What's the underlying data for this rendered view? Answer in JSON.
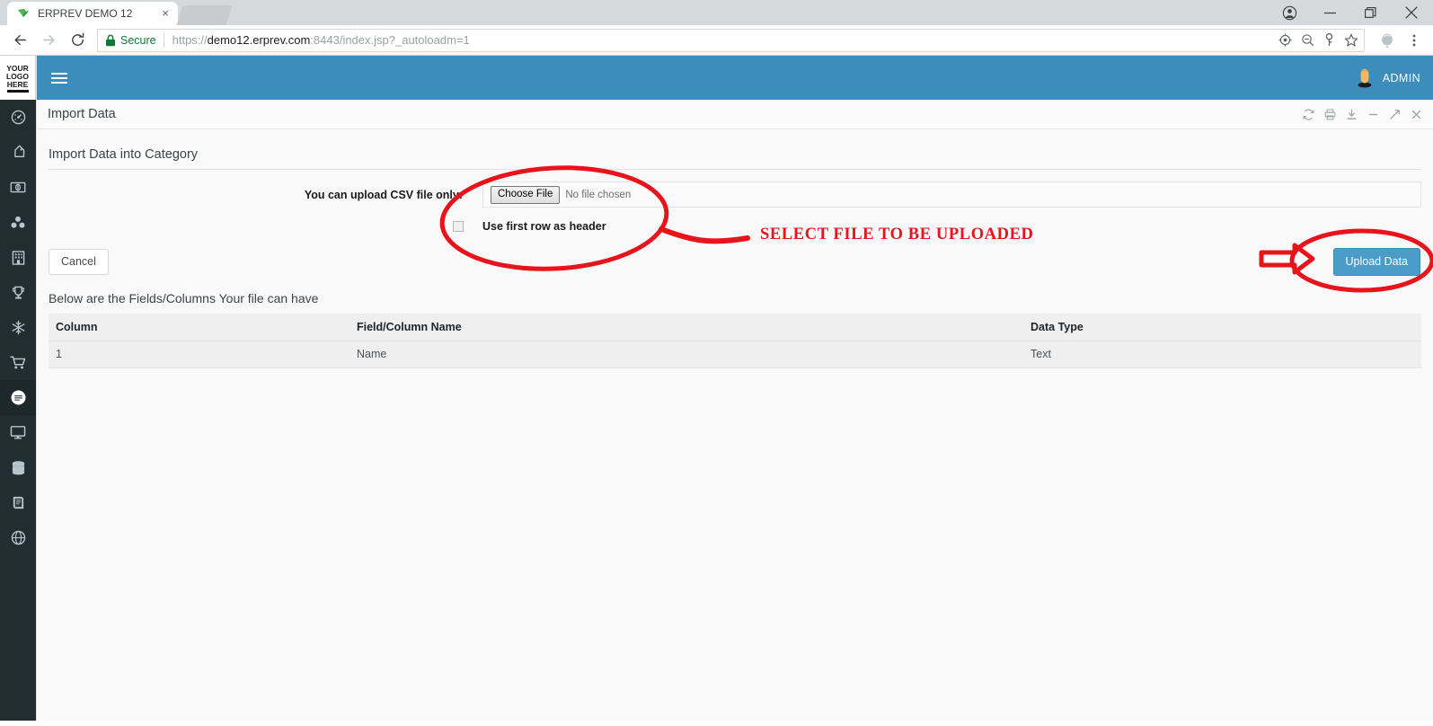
{
  "browser": {
    "tab": {
      "title": "ERPREV DEMO 12",
      "favicon": "bird-favicon",
      "close": "×"
    },
    "window_controls": {
      "profile": "profile-icon",
      "minimize": "—",
      "maximize": "maximize-icon",
      "close": "×"
    },
    "toolbar": {
      "back": "←",
      "forward": "→",
      "reload": "↻",
      "secure_label": "Secure",
      "url_full": "https://demo12.erprev.com:8443/index.jsp?_autoloadm=1",
      "url_scheme": "https://",
      "url_host": "demo12.erprev.com",
      "url_rest": ":8443/index.jsp?_autoloadm=1",
      "icons": [
        "location-target-icon",
        "zoom-out-icon",
        "key-icon",
        "bookmark-star-icon"
      ],
      "extension": "extension-balloon-icon",
      "menu": "kebab-menu-icon"
    }
  },
  "sidebar": {
    "logo": {
      "line1": "YOUR",
      "line2": "LOGO",
      "line3": "HERE"
    },
    "items": [
      {
        "name": "dashboard",
        "icon": "gauge-icon",
        "active": false
      },
      {
        "name": "tags",
        "icon": "tags-icon",
        "active": false
      },
      {
        "name": "money",
        "icon": "money-icon",
        "active": false
      },
      {
        "name": "cubes",
        "icon": "cubes-icon",
        "active": false
      },
      {
        "name": "building",
        "icon": "building-icon",
        "active": false
      },
      {
        "name": "trophy",
        "icon": "trophy-icon",
        "active": false
      },
      {
        "name": "snowflake",
        "icon": "snowflake-icon",
        "active": false
      },
      {
        "name": "cart",
        "icon": "shopping-cart-icon",
        "active": false
      },
      {
        "name": "chat",
        "icon": "comment-circle-icon",
        "active": true
      },
      {
        "name": "desktop",
        "icon": "desktop-icon",
        "active": false
      },
      {
        "name": "database",
        "icon": "database-icon",
        "active": false
      },
      {
        "name": "book",
        "icon": "book-icon",
        "active": false
      },
      {
        "name": "globe",
        "icon": "globe-icon",
        "active": false
      }
    ]
  },
  "topbar": {
    "menu_toggle": "hamburger-icon",
    "user_label": "ADMIN",
    "avatar": "user-avatar"
  },
  "panel": {
    "title": "Import Data",
    "tools": [
      {
        "name": "refresh",
        "glyph": "refresh-icon"
      },
      {
        "name": "print",
        "glyph": "print-icon"
      },
      {
        "name": "download",
        "glyph": "download-icon"
      },
      {
        "name": "minimize",
        "glyph": "minimize-icon"
      },
      {
        "name": "expand",
        "glyph": "expand-icon"
      },
      {
        "name": "close",
        "glyph": "close-icon"
      }
    ]
  },
  "form": {
    "section_title": "Import Data into Category",
    "upload_label": "You can upload CSV file only:",
    "choose_file_button": "Choose File",
    "no_file_chosen": "No file chosen",
    "checkbox_label": "Use first row as header",
    "checkbox_checked": false,
    "cancel_button": "Cancel",
    "upload_button": "Upload Data"
  },
  "fields": {
    "note": "Below are the Fields/Columns Your file can have",
    "headers": [
      "Column",
      "Field/Column Name",
      "Data Type"
    ],
    "rows": [
      [
        "1",
        "Name",
        "Text"
      ]
    ]
  },
  "annotations": {
    "text": "SELECT FILE TO BE UPLOADED",
    "color": "#e8141b",
    "shapes": [
      "ellipse-around-file-chooser",
      "line-connector-to-text",
      "arrow-pointing-to-upload-button",
      "ellipse-around-upload-button"
    ]
  },
  "colors": {
    "topbar_blue": "#3c8dbc",
    "sidebar_dark": "#222d32",
    "sidebar_active": "#1e282c",
    "sidebar_icon": "#b8c7ce",
    "page_bg": "#f9f9f9",
    "button_blue": "#4b9cc9",
    "annotation_red": "#e8141b",
    "secure_green": "#0b7b34",
    "table_row_bg": "#efefef"
  }
}
